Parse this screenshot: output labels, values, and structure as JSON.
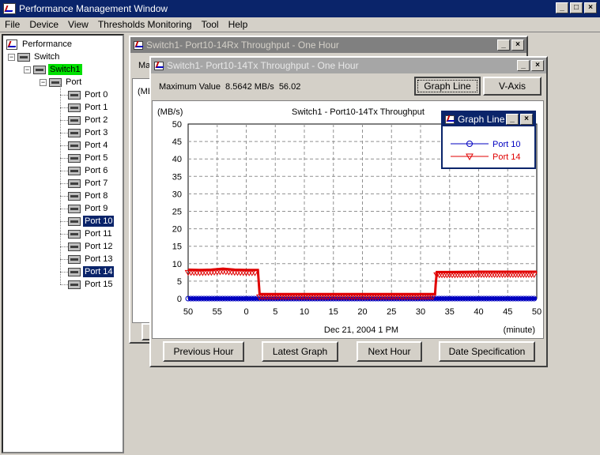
{
  "app": {
    "title": "Performance Management Window",
    "menu": [
      "File",
      "Device",
      "View",
      "Thresholds Monitoring",
      "Tool",
      "Help"
    ],
    "menu_underline": [
      "F",
      "D",
      "V",
      "T",
      "T",
      "H"
    ]
  },
  "tree": {
    "root": "Performance",
    "switch": "Switch",
    "switch1": "Switch1",
    "port_group": "Port",
    "ports": [
      "Port 0",
      "Port 1",
      "Port 2",
      "Port 3",
      "Port 4",
      "Port 5",
      "Port 6",
      "Port 7",
      "Port 8",
      "Port 9",
      "Port 10",
      "Port 11",
      "Port 12",
      "Port 13",
      "Port 14",
      "Port 15"
    ],
    "selected_ports": [
      "Port 10",
      "Port 14"
    ]
  },
  "back_window": {
    "title": "Switch1- Port10-14Rx Throughput - One Hour",
    "partial_label": "Ma",
    "partial_unit": "(MB"
  },
  "front_window": {
    "title": "Switch1- Port10-14Tx Throughput - One Hour",
    "max_label": "Maximum Value",
    "max_value": "8.5642 MB/s",
    "max_time": "56.02",
    "graph_line_button": "Graph Line",
    "v_axis_button": "V-Axis",
    "buttons": {
      "previous": "Previous Hour",
      "latest": "Latest Graph",
      "next": "Next Hour",
      "date": "Date Specification"
    }
  },
  "legend_window": {
    "title": "Graph Line"
  },
  "chart_data": {
    "type": "line",
    "title": "Switch1  - Port10-14Tx Throughput",
    "ylabel": "(MB/s)",
    "xlabel": "Dec 21, 2004 1 PM",
    "xunit": "(minute)",
    "ylim": [
      0,
      50
    ],
    "yticks": [
      0,
      5,
      10,
      15,
      20,
      25,
      30,
      35,
      40,
      45,
      50
    ],
    "xtick_labels": [
      "50",
      "55",
      "0",
      "5",
      "10",
      "15",
      "20",
      "25",
      "30",
      "35",
      "40",
      "45",
      "50"
    ],
    "grid": true,
    "legend_placement": "top-right",
    "series": [
      {
        "name": "Port 10",
        "color": "#0000c0",
        "marker": "circle",
        "points": [
          [
            50,
            0
          ],
          [
            55,
            0
          ],
          [
            60,
            0
          ],
          [
            65,
            0
          ],
          [
            70,
            0
          ],
          [
            75,
            0
          ],
          [
            80,
            0
          ],
          [
            85,
            0
          ],
          [
            90,
            0
          ],
          [
            95,
            0
          ],
          [
            100,
            0
          ],
          [
            105,
            0
          ],
          [
            110,
            0
          ]
        ]
      },
      {
        "name": "Port 14",
        "color": "#e00000",
        "marker": "triangle-down",
        "points": [
          [
            50,
            8.3
          ],
          [
            52,
            8.2
          ],
          [
            54,
            8.3
          ],
          [
            56,
            8.56
          ],
          [
            58,
            8.3
          ],
          [
            60,
            8.2
          ],
          [
            62,
            8.2
          ],
          [
            62.3,
            1.3
          ],
          [
            65,
            1.3
          ],
          [
            70,
            1.3
          ],
          [
            75,
            1.3
          ],
          [
            80,
            1.3
          ],
          [
            85,
            1.3
          ],
          [
            90,
            1.3
          ],
          [
            92.5,
            1.3
          ],
          [
            92.6,
            4.0
          ],
          [
            92.8,
            7.6
          ],
          [
            95,
            7.6
          ],
          [
            100,
            7.7
          ],
          [
            105,
            7.7
          ],
          [
            110,
            7.7
          ]
        ]
      }
    ]
  }
}
